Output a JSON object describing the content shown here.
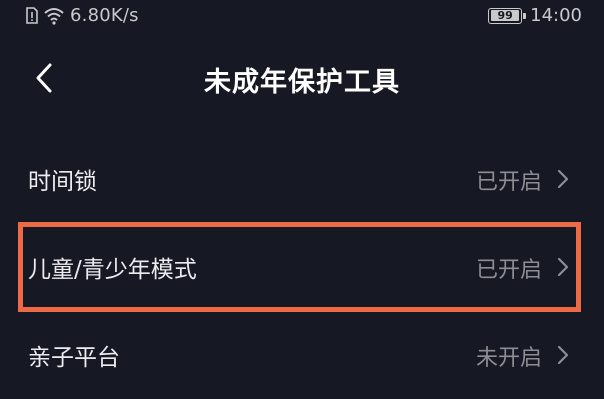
{
  "status_bar": {
    "net_speed": "6.80K/s",
    "battery_level": "99",
    "time": "14:00",
    "icons": [
      "sim-alert-icon",
      "wifi-icon",
      "battery-icon"
    ]
  },
  "header": {
    "back_icon": "chevron-left-icon",
    "title": "未成年保护工具"
  },
  "settings": [
    {
      "label": "时间锁",
      "status": "已开启"
    },
    {
      "label": "儿童/青少年模式",
      "status": "已开启"
    },
    {
      "label": "亲子平台",
      "status": "未开启"
    }
  ],
  "colors": {
    "background": "#161823",
    "highlight": "#ee6a46",
    "status_text": "#8d8e94"
  }
}
